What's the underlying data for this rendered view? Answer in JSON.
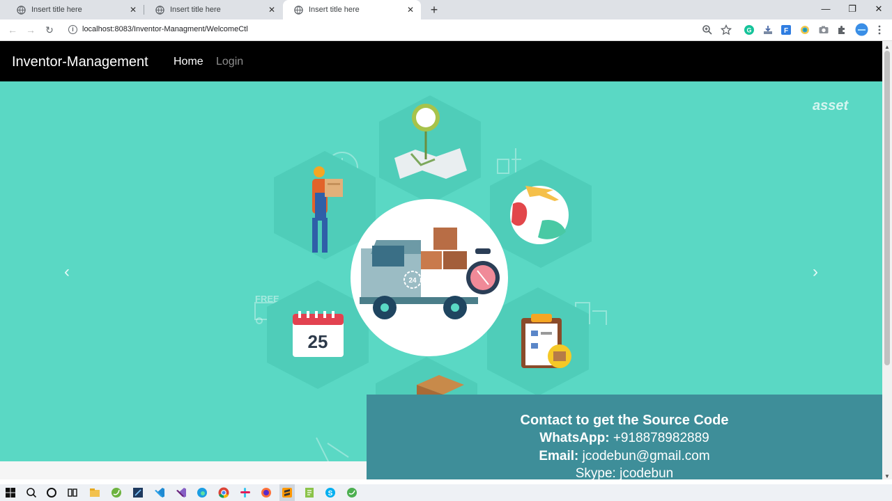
{
  "browser": {
    "tabs": [
      {
        "title": "Insert title here",
        "active": false
      },
      {
        "title": "Insert title here",
        "active": false
      },
      {
        "title": "Insert title here",
        "active": true
      }
    ],
    "new_tab_label": "+",
    "window_controls": {
      "minimize": "—",
      "restore": "❐",
      "close": "✕"
    },
    "nav": {
      "back": "←",
      "forward": "→",
      "reload": "↻"
    },
    "url": "localhost:8083/Inventor-Managment/WelcomeCtl",
    "toolbar_icons": [
      "zoom-icon",
      "bookmark-star-icon",
      "grammarly-icon",
      "download-icon",
      "extension-f-icon",
      "color-extension-icon",
      "camera-icon",
      "extensions-puzzle-icon",
      "profile-icon",
      "menu-icon"
    ]
  },
  "site": {
    "brand": "Inventor-Management",
    "nav_links": [
      "Home",
      "Login"
    ]
  },
  "carousel": {
    "prev": "‹",
    "next": "›",
    "watermark": "asset",
    "calendar_day": "25",
    "truck_badge": "24",
    "free_label": "FREE",
    "bg_color": "#5ad8c4"
  },
  "contact": {
    "heading": "Contact to get the Source Code",
    "whatsapp_label": "WhatsApp:",
    "whatsapp_value": "+918878982889",
    "email_label": "Email:",
    "email_value": "jcodebun@gmail.com",
    "skype_label": "Skype:",
    "skype_value": "jcodebun",
    "bg_color": "#3e8e99"
  },
  "taskbar": {
    "icons": [
      "windows-start-icon",
      "search-icon",
      "cortana-icon",
      "task-view-icon",
      "file-explorer-icon",
      "spring-tool-icon",
      "editor-icon",
      "vscode-icon",
      "visual-studio-icon",
      "edge-icon",
      "chrome-icon",
      "slack-icon",
      "firefox-icon",
      "sublime-icon",
      "notepadpp-icon",
      "skype-icon",
      "green-app-icon"
    ]
  }
}
